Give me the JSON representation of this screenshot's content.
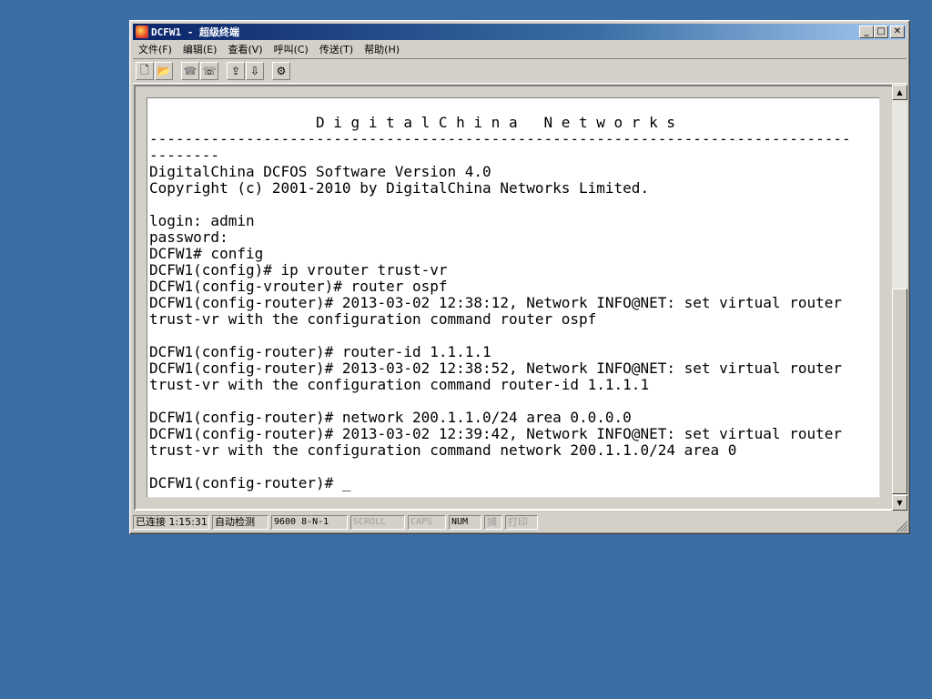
{
  "window": {
    "title": "DCFW1 - 超级终端",
    "caption_buttons": {
      "minimize": "_",
      "maximize": "□",
      "close": "✕"
    }
  },
  "menu": [
    "文件(F)",
    "编辑(E)",
    "查看(V)",
    "呼叫(C)",
    "传送(T)",
    "帮助(H)"
  ],
  "toolbar": {
    "icons": [
      "new-icon",
      "open-icon",
      "connect-icon",
      "disconnect-icon",
      "send-icon",
      "receive-icon",
      "properties-icon"
    ],
    "glyphs": [
      "🗋",
      "📂",
      "☎",
      "☏",
      "⇪",
      "⇩",
      "⚙"
    ]
  },
  "terminal": {
    "lines": [
      "                   D i g i t a l C h i n a   N e t w o r k s",
      "--------------------------------------------------------------------------------",
      "--------",
      "DigitalChina DCFOS Software Version 4.0",
      "Copyright (c) 2001-2010 by DigitalChina Networks Limited.",
      "",
      "login: admin",
      "password:",
      "DCFW1# config",
      "DCFW1(config)# ip vrouter trust-vr",
      "DCFW1(config-vrouter)# router ospf",
      "DCFW1(config-router)# 2013-03-02 12:38:12, Network INFO@NET: set virtual router",
      "trust-vr with the configuration command router ospf",
      "",
      "DCFW1(config-router)# router-id 1.1.1.1",
      "DCFW1(config-router)# 2013-03-02 12:38:52, Network INFO@NET: set virtual router",
      "trust-vr with the configuration command router-id 1.1.1.1",
      "",
      "DCFW1(config-router)# network 200.1.1.0/24 area 0.0.0.0",
      "DCFW1(config-router)# 2013-03-02 12:39:42, Network INFO@NET: set virtual router",
      "trust-vr with the configuration command network 200.1.1.0/24 area 0",
      "",
      "DCFW1(config-router)# _"
    ]
  },
  "statusbar": {
    "connected": "已连接 1:15:31",
    "detect": "自动检测",
    "port": "9600 8-N-1",
    "scroll": "SCROLL",
    "caps": "CAPS",
    "num": "NUM",
    "capture": "捕",
    "print": "打印"
  },
  "colors": {
    "desktop": "#3a6ea5",
    "title_active": "#0a246a",
    "chrome": "#d4d0c8",
    "terminal_bg": "#ffffff"
  }
}
